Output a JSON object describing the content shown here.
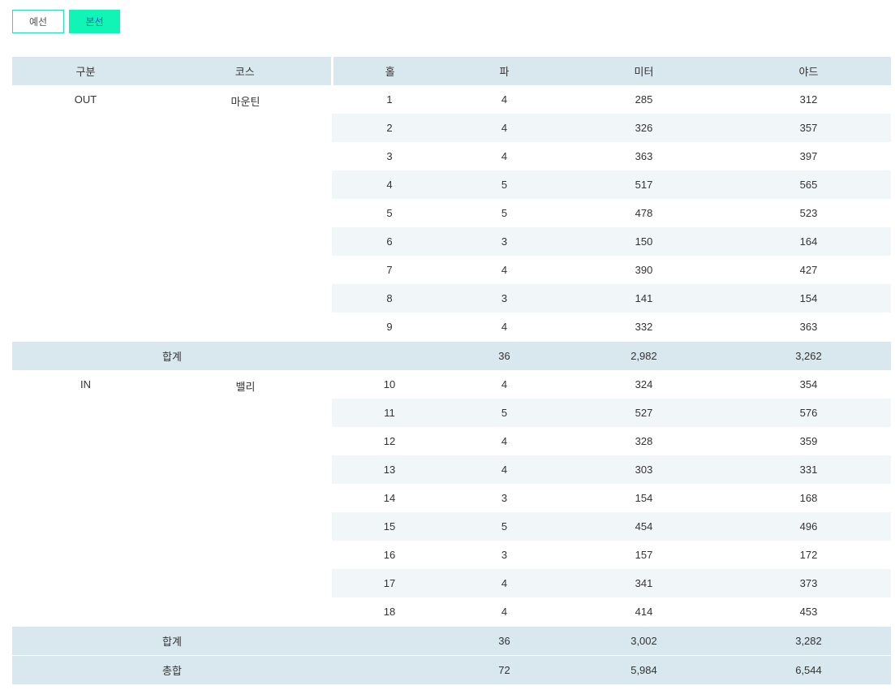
{
  "tabs": [
    {
      "label": "예선",
      "selected": false
    },
    {
      "label": "본선",
      "selected": true
    }
  ],
  "table": {
    "headers": [
      "구분",
      "코스",
      "홀",
      "파",
      "미터",
      "야드"
    ],
    "sections": [
      {
        "division": "OUT",
        "course": "마운틴",
        "holes": [
          {
            "hole": "1",
            "par": "4",
            "meter": "285",
            "yard": "312"
          },
          {
            "hole": "2",
            "par": "4",
            "meter": "326",
            "yard": "357"
          },
          {
            "hole": "3",
            "par": "4",
            "meter": "363",
            "yard": "397"
          },
          {
            "hole": "4",
            "par": "5",
            "meter": "517",
            "yard": "565"
          },
          {
            "hole": "5",
            "par": "5",
            "meter": "478",
            "yard": "523"
          },
          {
            "hole": "6",
            "par": "3",
            "meter": "150",
            "yard": "164"
          },
          {
            "hole": "7",
            "par": "4",
            "meter": "390",
            "yard": "427"
          },
          {
            "hole": "8",
            "par": "3",
            "meter": "141",
            "yard": "154"
          },
          {
            "hole": "9",
            "par": "4",
            "meter": "332",
            "yard": "363"
          }
        ],
        "subtotal": {
          "label": "합계",
          "par": "36",
          "meter": "2,982",
          "yard": "3,262"
        }
      },
      {
        "division": "IN",
        "course": "밸리",
        "holes": [
          {
            "hole": "10",
            "par": "4",
            "meter": "324",
            "yard": "354"
          },
          {
            "hole": "11",
            "par": "5",
            "meter": "527",
            "yard": "576"
          },
          {
            "hole": "12",
            "par": "4",
            "meter": "328",
            "yard": "359"
          },
          {
            "hole": "13",
            "par": "4",
            "meter": "303",
            "yard": "331"
          },
          {
            "hole": "14",
            "par": "3",
            "meter": "154",
            "yard": "168"
          },
          {
            "hole": "15",
            "par": "5",
            "meter": "454",
            "yard": "496"
          },
          {
            "hole": "16",
            "par": "3",
            "meter": "157",
            "yard": "172"
          },
          {
            "hole": "17",
            "par": "4",
            "meter": "341",
            "yard": "373"
          },
          {
            "hole": "18",
            "par": "4",
            "meter": "414",
            "yard": "453"
          }
        ],
        "subtotal": {
          "label": "합계",
          "par": "36",
          "meter": "3,002",
          "yard": "3,282"
        }
      }
    ],
    "total": {
      "label": "총합",
      "par": "72",
      "meter": "5,984",
      "yard": "6,544"
    }
  },
  "colors": {
    "header_bg": "#d9e7ee",
    "alt_row_bg": "#f1f6f8",
    "tab_accent": "#10f5b5"
  }
}
